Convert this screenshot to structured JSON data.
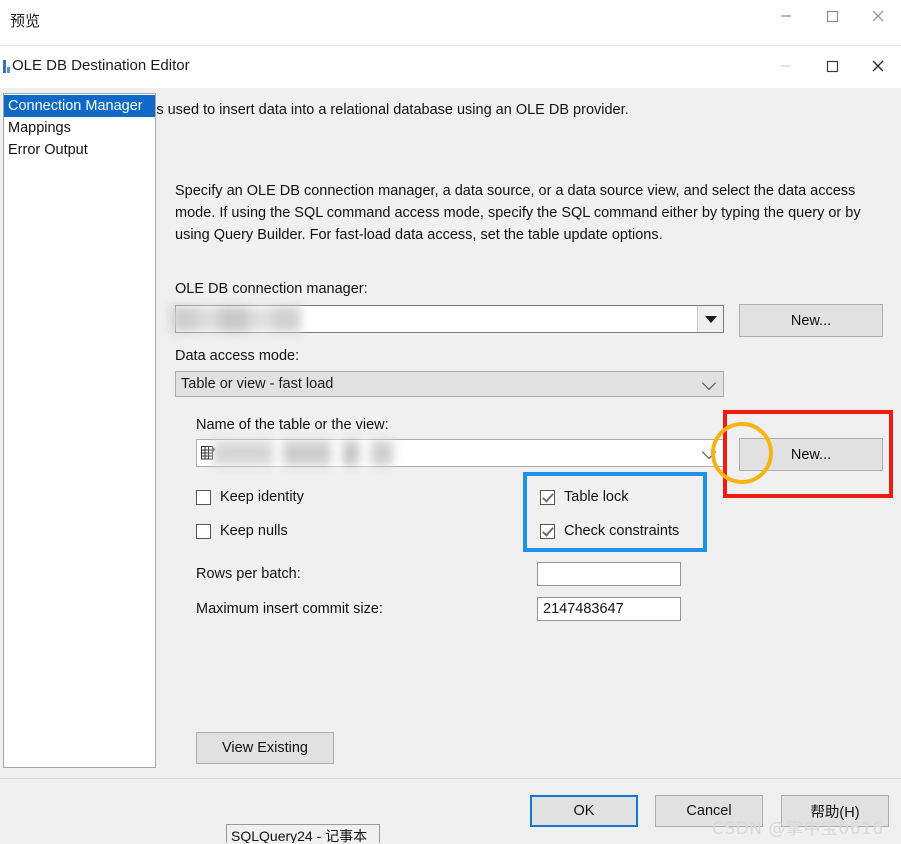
{
  "outer_window": {
    "title": "预览",
    "controls": {
      "minimize": "minimize-icon",
      "maximize": "maximize-icon",
      "close": "close-icon"
    }
  },
  "dialog": {
    "title": "OLE DB Destination Editor",
    "description": "Configure the properties used to insert data into a relational database using an OLE DB provider.",
    "controls": {
      "minimize": "minimize-icon",
      "maximize": "maximize-icon",
      "close": "close-icon"
    }
  },
  "sidebar": {
    "items": [
      {
        "label": "Connection Manager",
        "selected": true
      },
      {
        "label": "Mappings",
        "selected": false
      },
      {
        "label": "Error Output",
        "selected": false
      }
    ]
  },
  "main": {
    "intro": "Specify an OLE DB connection manager, a data source, or a data source view, and select the data access mode. If using the SQL command access mode, specify the SQL command either by typing the query or by using Query Builder. For fast-load data access, set the table update options.",
    "connection_manager": {
      "label": "OLE DB connection manager:",
      "value": "",
      "redacted": true,
      "new_button": "New..."
    },
    "data_access_mode": {
      "label": "Data access mode:",
      "value": "Table or view - fast load"
    },
    "table_or_view": {
      "label": "Name of the table or the view:",
      "value": "",
      "redacted": true,
      "icon": "table-icon",
      "new_button": "New..."
    },
    "options": [
      {
        "label": "Keep identity",
        "checked": false
      },
      {
        "label": "Keep nulls",
        "checked": false
      },
      {
        "label": "Table lock",
        "checked": true
      },
      {
        "label": "Check constraints",
        "checked": true
      }
    ],
    "rows_per_batch": {
      "label": "Rows per batch:",
      "value": "",
      "placeholder": ""
    },
    "max_insert_commit_size": {
      "label": "Maximum insert commit size:",
      "value": "2147483647"
    },
    "view_existing_button": "View Existing"
  },
  "footer": {
    "ok": "OK",
    "cancel": "Cancel",
    "help": "帮助(H)"
  },
  "annotations": {
    "red_box_target": "new-table-button",
    "blue_box_target": "fastload-checkbox-group",
    "orange_circle_target": "table-or-view-dropdown-arrow",
    "colors": {
      "red": "#ef1c12",
      "blue": "#1e90e8",
      "orange": "#f5b411"
    }
  },
  "watermark": "CSDN @掌中宝0616",
  "taskbar": {
    "item": "SQLQuery24 - 记事本"
  }
}
